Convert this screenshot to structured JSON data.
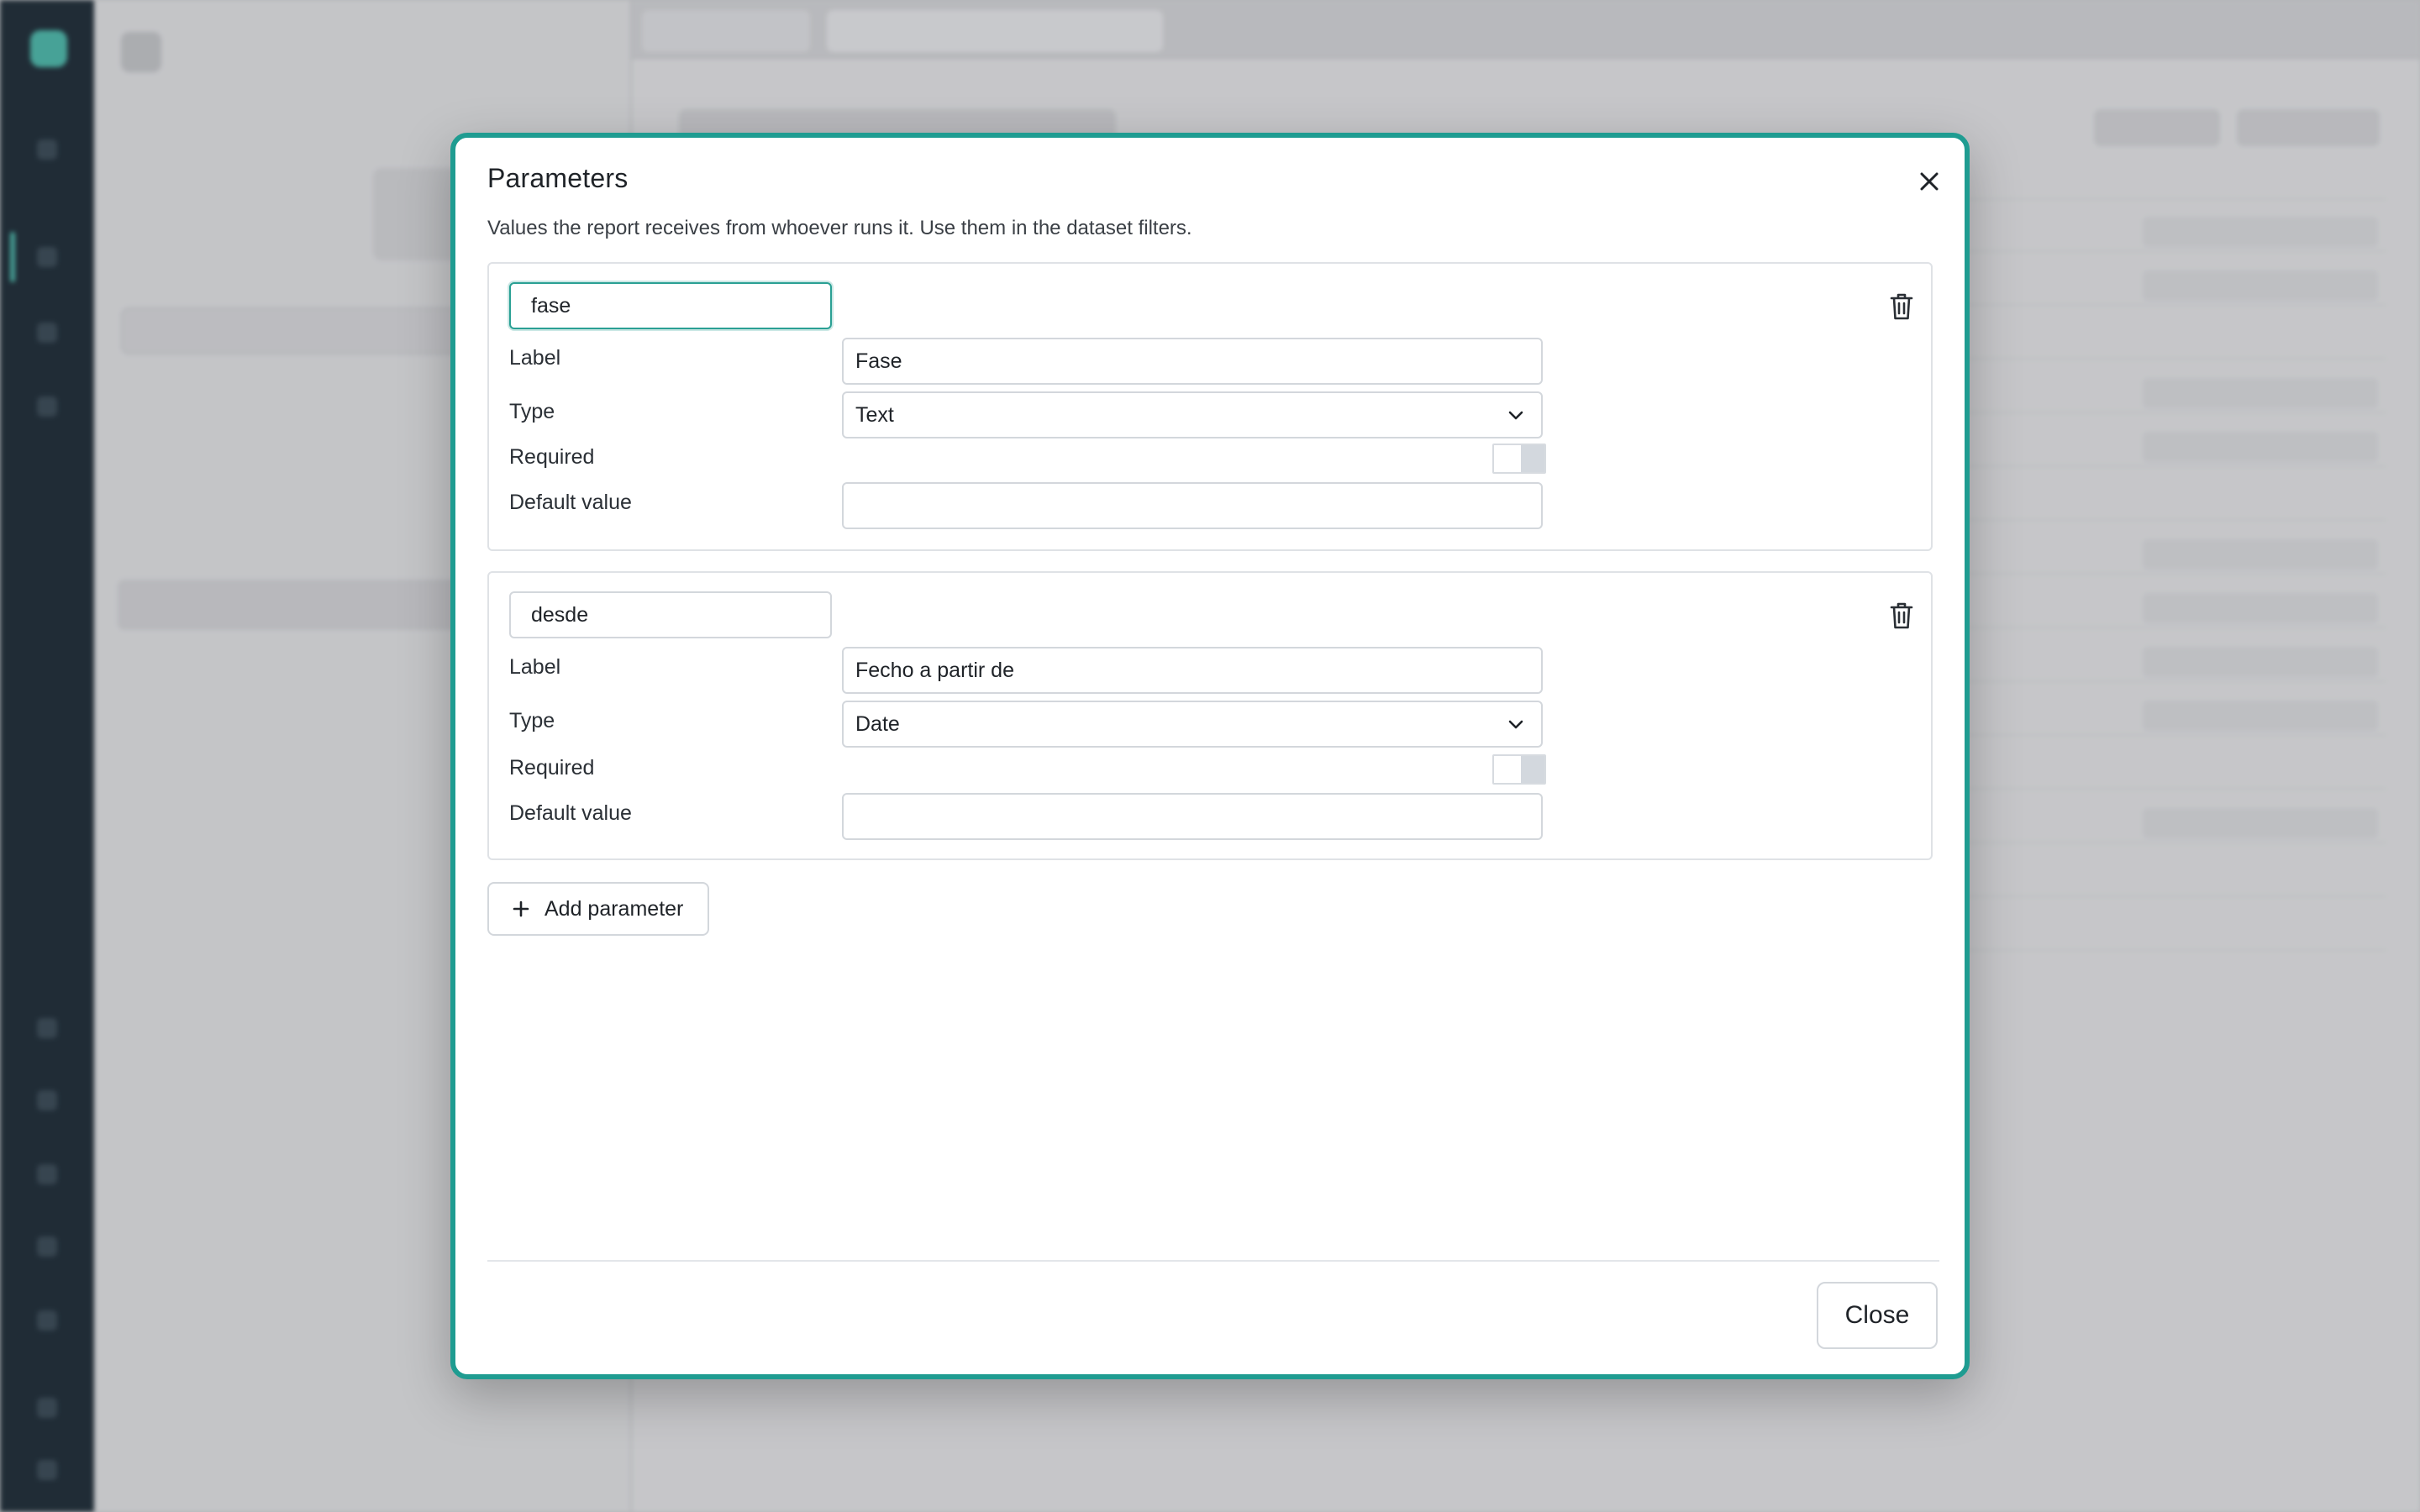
{
  "modal": {
    "title": "Parameters",
    "description": "Values the report receives from whoever runs it. Use them in the dataset filters.",
    "close_label": "Close",
    "add_parameter_label": "Add parameter"
  },
  "field_labels": {
    "label": "Label",
    "type": "Type",
    "required": "Required",
    "default_value": "Default value"
  },
  "parameters": [
    {
      "name": "fase",
      "label": "Fase",
      "type": "Text",
      "required": false,
      "default_value": ""
    },
    {
      "name": "desde",
      "label": "Fecho a partir de",
      "type": "Date",
      "required": false,
      "default_value": ""
    }
  ],
  "colors": {
    "accent": "#1f9c91",
    "rail": "#0f1e29"
  },
  "icons": {
    "close": "close-icon",
    "delete": "trash-icon",
    "dropdown": "chevron-down-icon",
    "add": "plus-icon"
  }
}
